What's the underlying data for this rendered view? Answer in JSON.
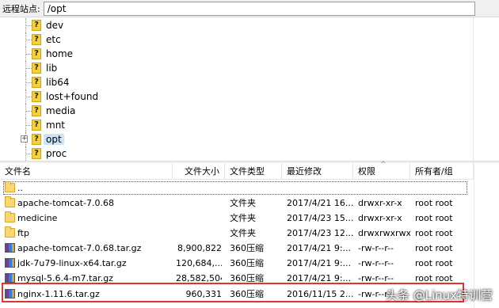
{
  "remote_site": {
    "label": "远程站点:",
    "path": "/opt"
  },
  "tree": {
    "items": [
      {
        "name": "dev",
        "selected": false
      },
      {
        "name": "etc",
        "selected": false
      },
      {
        "name": "home",
        "selected": false
      },
      {
        "name": "lib",
        "selected": false
      },
      {
        "name": "lib64",
        "selected": false
      },
      {
        "name": "lost+found",
        "selected": false
      },
      {
        "name": "media",
        "selected": false
      },
      {
        "name": "mnt",
        "selected": false
      },
      {
        "name": "opt",
        "selected": true,
        "expander": "+"
      },
      {
        "name": "proc",
        "selected": false
      }
    ],
    "icon_glyph": "?"
  },
  "file_list": {
    "columns": {
      "name": "文件名",
      "size": "文件大小",
      "type": "文件类型",
      "modified": "最近修改",
      "perms": "权限",
      "owner": "所有者/组"
    },
    "sort_indicator": "^",
    "rows": [
      {
        "name": "..",
        "size": "",
        "type": "",
        "modified": "",
        "perms": "",
        "owner": "",
        "icon": "folder-icon"
      },
      {
        "name": "apache-tomcat-7.0.68",
        "size": "",
        "type": "文件夹",
        "modified": "2017/4/21 16...",
        "perms": "drwxr-xr-x",
        "owner": "root root",
        "icon": "folder-icon"
      },
      {
        "name": "medicine",
        "size": "",
        "type": "文件夹",
        "modified": "2017/4/23 15...",
        "perms": "drwxr-xr-x",
        "owner": "root root",
        "icon": "folder-icon"
      },
      {
        "name": "ftp",
        "size": "",
        "type": "文件夹",
        "modified": "2017/4/23 12...",
        "perms": "drwxrwxrwx",
        "owner": "root root",
        "icon": "folder-icon"
      },
      {
        "name": "apache-tomcat-7.0.68.tar.gz",
        "size": "8,900,822",
        "type": "360压缩",
        "modified": "2017/4/21 9:...",
        "perms": "-rw-r--r--",
        "owner": "root root",
        "icon": "archive-icon"
      },
      {
        "name": "jdk-7u79-linux-x64.tar.gz",
        "size": "120,684,...",
        "type": "360压缩",
        "modified": "2017/4/21 9:...",
        "perms": "-rw-r--r--",
        "owner": "root root",
        "icon": "archive-icon"
      },
      {
        "name": "mysql-5.6.4-m7.tar.gz",
        "size": "28,582,504",
        "type": "360压缩",
        "modified": "2017/4/21 9:...",
        "perms": "-rw-r--r--",
        "owner": "root root",
        "icon": "archive-icon"
      },
      {
        "name": "nginx-1.11.6.tar.gz",
        "size": "960,331",
        "type": "360压缩",
        "modified": "2016/11/15 2...",
        "perms": "-rw-r--r--",
        "owner": "",
        "icon": "archive-icon"
      }
    ]
  },
  "watermark": "头条 @Linux特训营",
  "colors": {
    "highlight_border": "#e0342c",
    "selection": "#cce4f7"
  }
}
